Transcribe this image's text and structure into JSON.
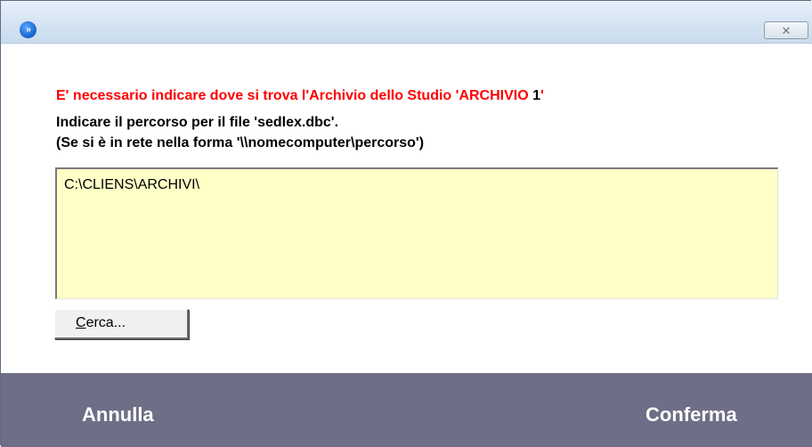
{
  "window": {
    "app_icon": "double-chevron-right-icon",
    "close_icon": "close-icon",
    "close_glyph": "✕"
  },
  "dialog": {
    "message_red": "E' necessario indicare dove si trova l'Archivio dello Studio 'ARCHIVIO ",
    "archive_number": "1",
    "message_red_end": "'",
    "instruction_line1": "Indicare il percorso per il file 'sedlex.dbc'.",
    "instruction_line2": "(Se si è in rete nella forma '\\\\nomecomputer\\percorso')",
    "path_value": "C:\\CLIENS\\ARCHIVI\\",
    "cerca_label_first": "C",
    "cerca_label_rest": "erca..."
  },
  "footer": {
    "cancel_label": "Annulla",
    "confirm_label": "Conferma"
  },
  "colors": {
    "title_bar": "#d8e6f4",
    "error_text": "#ff0000",
    "input_background": "#ffffc8",
    "footer_background": "#6f6e87"
  }
}
